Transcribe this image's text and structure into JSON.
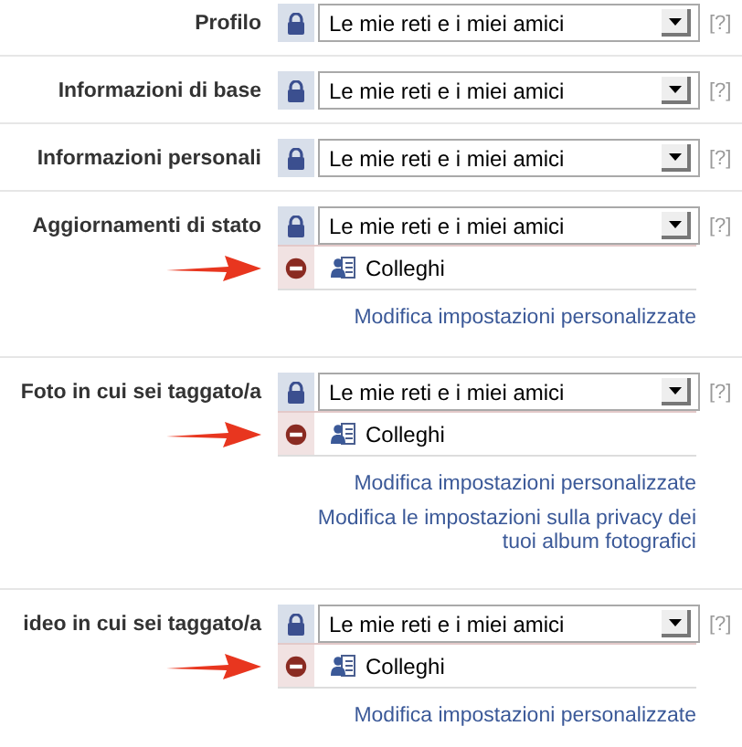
{
  "sections": [
    {
      "label": "Profilo",
      "privacy": "Le mie reti e i miei amici",
      "help": "[?]"
    },
    {
      "label": "Informazioni di base",
      "privacy": "Le mie reti e i miei amici",
      "help": "[?]"
    },
    {
      "label": "Informazioni personali",
      "privacy": "Le mie reti e i miei amici",
      "help": "[?]"
    },
    {
      "label": "Aggiornamenti di stato",
      "privacy": "Le mie reti e i miei amici",
      "help": "[?]",
      "exceptions": [
        {
          "name": "Colleghi",
          "arrow": true
        }
      ],
      "links": [
        "Modifica impostazioni personalizzate"
      ]
    },
    {
      "label": "Foto in cui sei taggato/a",
      "privacy": "Le mie reti e i miei amici",
      "help": "[?]",
      "exceptions": [
        {
          "name": "Colleghi",
          "arrow": true
        }
      ],
      "links": [
        "Modifica impostazioni personalizzate",
        "Modifica le impostazioni sulla privacy dei tuoi album fotografici"
      ]
    },
    {
      "label": "ideo in cui sei taggato/a",
      "privacy": "Le mie reti e i miei amici",
      "help": "[?]",
      "exceptions": [
        {
          "name": "Colleghi",
          "arrow": true
        }
      ],
      "links": [
        "Modifica impostazioni personalizzate"
      ]
    }
  ]
}
